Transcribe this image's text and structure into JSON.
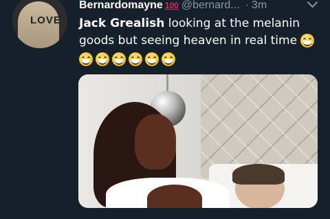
{
  "tweet": {
    "display_name": "Bernardomayne",
    "name_emoji": "100",
    "handle": "@bernard...",
    "separator": "·",
    "time": "3m",
    "text_bold": "Jack Grealish",
    "text_rest": " looking at the melanin goods  but seeing heaven in real time",
    "trailing_emoji": "grinning-squinting-face-emoji",
    "emoji_row_count": 6
  },
  "avatar": {
    "print_text": "LOVE"
  },
  "colors": {
    "background": "#15202b",
    "secondary_text": "#8899a6",
    "hundred_emoji": "#e0245e",
    "emoji_yellow": "#f7c531"
  }
}
